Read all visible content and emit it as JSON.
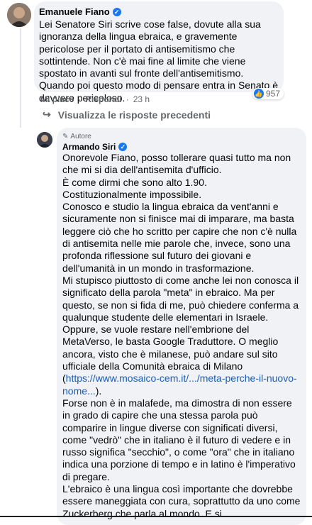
{
  "comment1": {
    "author": "Emanuele Fiano",
    "text": "Lei Senatore Siri scrive cose false, dovute alla sua ignoranza della lingua ebraica, e gravemente pericolose per il portato di antisemitismo che sottintende. Non c'è mai fine al limite che viene spostato in avanti sul fronte dell'antisemitismo. Quando poi questo modo di pensare entra in Senato è davvero pericoloso.",
    "like_label": "Mi piace",
    "reply_label": "Rispondi",
    "time": "23 h",
    "reactions_count": "957"
  },
  "show_previous_replies": "Visualizza le risposte precedenti",
  "comment2": {
    "role": "Autore",
    "author": "Armando Siri",
    "text_before_link": "Onorevole Fiano, posso tollerare quasi tutto ma non che mi si dia dell'antisemita d'ufficio.\nÈ come dirmi che sono alto 1.90.\nCostituzionalmente impossibile.\nConosco e studio la lingua ebraica da vent'anni e sicuramente non si finisce mai di imparare, ma basta leggere ciò che ho scritto per capire che non c'è nulla di antisemita nelle mie parole che, invece, sono una profonda riflessione sul futuro dei giovani e dell'umanità in un mondo in trasformazione.\nMi stupisco piuttosto di come anche lei non conosca il significato della parola \"meta\" in ebraico. Ma per questo, se non si fida di me, può chiedere conferma a qualunque studente delle elementari in Israele. Oppure, se vuole restare nell'embrione del MetaVerso, le basta Google Traduttore. O meglio ancora, visto che è milanese, può andare sul sito ufficiale della Comunità ebraica di Milano\n(",
    "link": "https://www.mosaico-cem.it/.../meta-perche-il-nuovo-nome...",
    "text_after_link": ").\nForse non è in malafede, ma dimostra di non essere in grado di capire che una stessa parola può comparire in lingue diverse con significati diversi, come \"vedrò\" che in italiano è il futuro di vedere e in russo significa \"secchio\", o come \"ora\" che in italiano indica una porzione di tempo e in latino è l'imperativo di pregare.\nL'ebraico è una lingua così importante che dovrebbe essere maneggiata con cura, soprattutto da uno come Zuckerberg che parla al mondo. E si"
  }
}
